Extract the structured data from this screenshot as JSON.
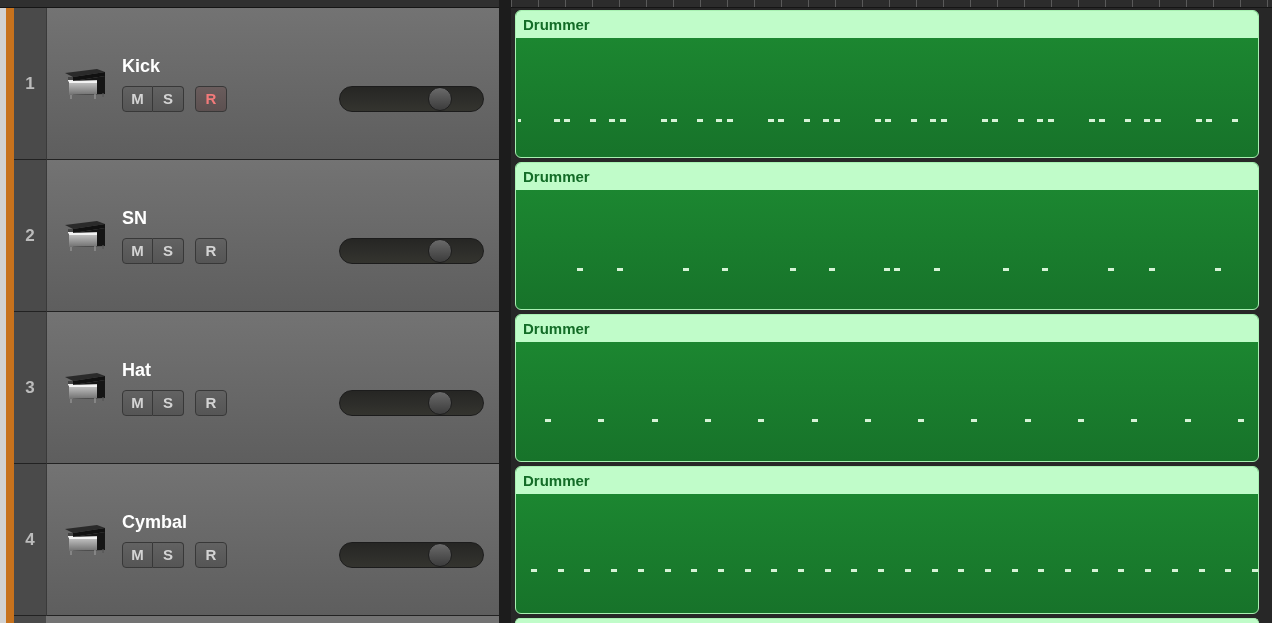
{
  "tracks": [
    {
      "number": "1",
      "name": "Kick",
      "buttons": [
        {
          "kind": "mute",
          "label": "M",
          "on": false
        },
        {
          "kind": "solo",
          "label": "S",
          "on": false
        },
        {
          "kind": "record",
          "label": "R",
          "on": true
        }
      ],
      "volume": {
        "level": 0.74
      },
      "region": {
        "title": "Drummer"
      }
    },
    {
      "number": "2",
      "name": "SN",
      "buttons": [
        {
          "kind": "mute",
          "label": "M",
          "on": false
        },
        {
          "kind": "solo",
          "label": "S",
          "on": false
        },
        {
          "kind": "record",
          "label": "R",
          "on": false
        }
      ],
      "volume": {
        "level": 0.74
      },
      "region": {
        "title": "Drummer"
      }
    },
    {
      "number": "3",
      "name": "Hat",
      "buttons": [
        {
          "kind": "mute",
          "label": "M",
          "on": false
        },
        {
          "kind": "solo",
          "label": "S",
          "on": false
        },
        {
          "kind": "record",
          "label": "R",
          "on": false
        }
      ],
      "volume": {
        "level": 0.74
      },
      "region": {
        "title": "Drummer"
      }
    },
    {
      "number": "4",
      "name": "Cymbal",
      "buttons": [
        {
          "kind": "mute",
          "label": "M",
          "on": false
        },
        {
          "kind": "solo",
          "label": "S",
          "on": false
        },
        {
          "kind": "record",
          "label": "R",
          "on": false
        }
      ],
      "volume": {
        "level": 0.74
      },
      "region": {
        "title": "Drummer"
      }
    }
  ]
}
